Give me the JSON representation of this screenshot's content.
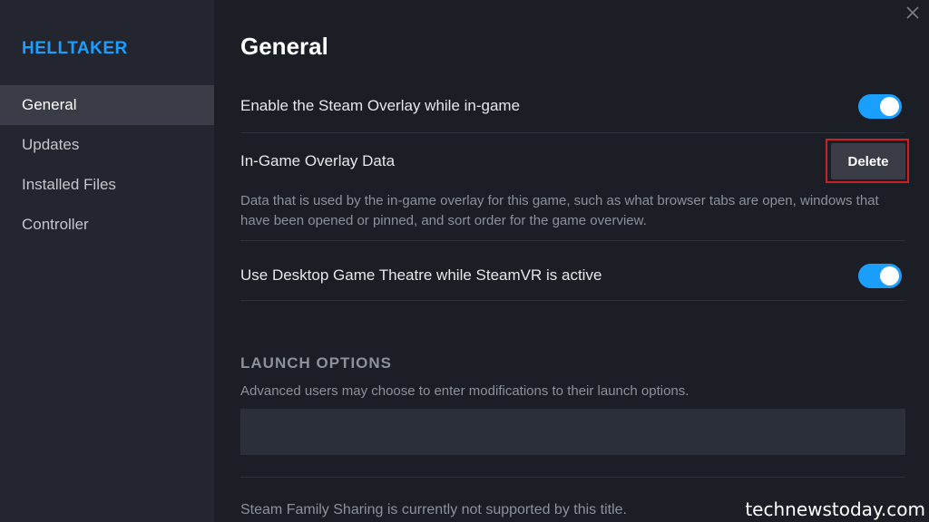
{
  "sidebar": {
    "game_title": "HELLTAKER",
    "items": [
      {
        "label": "General",
        "active": true
      },
      {
        "label": "Updates",
        "active": false
      },
      {
        "label": "Installed Files",
        "active": false
      },
      {
        "label": "Controller",
        "active": false
      }
    ]
  },
  "window": {
    "close_icon": "close-icon"
  },
  "main": {
    "title": "General",
    "overlay": {
      "label": "Enable the Steam Overlay while in-game",
      "enabled": true
    },
    "overlay_data": {
      "label": "In-Game Overlay Data",
      "button_label": "Delete",
      "description": "Data that is used by the in-game overlay for this game, such as what browser tabs are open, windows that have been opened or pinned, and sort order for the game overview."
    },
    "theatre": {
      "label": "Use Desktop Game Theatre while SteamVR is active",
      "enabled": true
    },
    "launch_options": {
      "heading": "LAUNCH OPTIONS",
      "description": "Advanced users may choose to enter modifications to their launch options.",
      "value": ""
    },
    "family_sharing_note": "Steam Family Sharing is currently not supported by this title."
  },
  "watermark": "technewstoday.com",
  "colors": {
    "accent": "#1a9fff",
    "background": "#1b1e25",
    "sidebar": "#23262e",
    "highlight": "#d11f26"
  }
}
